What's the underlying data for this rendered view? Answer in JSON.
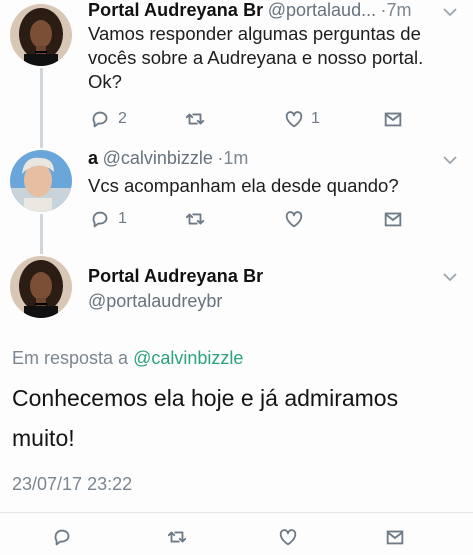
{
  "tweets": [
    {
      "name": "Portal Audreyana Br",
      "handle": "@portalaud...",
      "dot": "·",
      "time": "7m",
      "text_line1": "Vamos responder algumas perguntas de",
      "text_line2": "vocês sobre a Audreyana e nosso portal.",
      "text_line3": "Ok?",
      "reply_count": "2",
      "retweet_count": "",
      "like_count": "1"
    },
    {
      "name": "a",
      "handle": "@calvinbizzle",
      "dot": "·",
      "time": "1m",
      "text_line1": "Vcs acompanham ela desde quando?",
      "reply_count": "1",
      "retweet_count": "",
      "like_count": ""
    }
  ],
  "focused": {
    "name": "Portal Audreyana Br",
    "handle": "@portalaudreybr",
    "reply_prefix": "Em resposta a",
    "reply_mention": "@calvinbizzle",
    "text_line1": "Conhecemos ela hoje e já admiramos",
    "text_line2": "muito!",
    "datetime": "23/07/17 23:22"
  },
  "colors": {
    "mention": "#2aa37a",
    "thread_line": "#cfd6dc",
    "icon_gray": "#6e7b86"
  },
  "icons": [
    "reply-icon",
    "retweet-icon",
    "like-icon",
    "dm-icon",
    "chevron-down-icon"
  ]
}
